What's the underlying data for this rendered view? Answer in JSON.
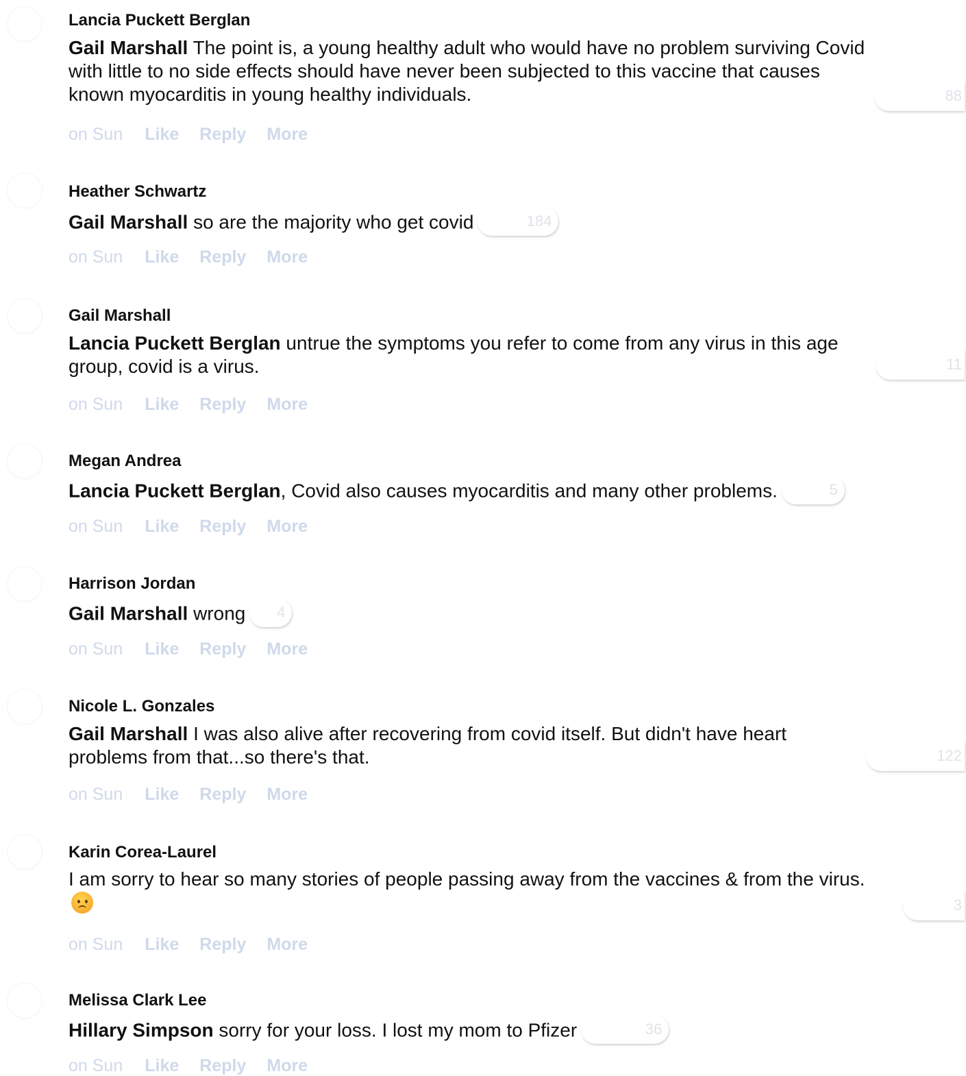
{
  "comments": [
    {
      "author": "Lancia Puckett Berglan",
      "mention": "Gail Marshall",
      "text": " The point is, a young healthy adult who would have no problem surviving Covid with little to no side effects should have never been subjected to this vaccine that causes known myocarditis in young healthy individuals.",
      "reaction_count": "88",
      "timestamp": "on Sun",
      "like_label": "Like",
      "reply_label": "Reply",
      "more_label": "More"
    },
    {
      "author": "Heather Schwartz",
      "mention": "Gail Marshall",
      "text": " so are the majority who get covid",
      "reaction_count": "184",
      "timestamp": "on Sun",
      "like_label": "Like",
      "reply_label": "Reply",
      "more_label": "More"
    },
    {
      "author": "Gail Marshall",
      "mention": "Lancia Puckett Berglan",
      "text": " untrue the symptoms you refer to come from any virus in this age group, covid is a virus.",
      "reaction_count": "11",
      "timestamp": "on Sun",
      "like_label": "Like",
      "reply_label": "Reply",
      "more_label": "More"
    },
    {
      "author": "Megan Andrea",
      "mention": "Lancia Puckett Berglan",
      "text": ", Covid also causes myocarditis and many other problems.",
      "reaction_count": "5",
      "timestamp": "on Sun",
      "like_label": "Like",
      "reply_label": "Reply",
      "more_label": "More"
    },
    {
      "author": "Harrison Jordan",
      "mention": "Gail Marshall",
      "text": " wrong",
      "reaction_count": "4",
      "timestamp": "on Sun",
      "like_label": "Like",
      "reply_label": "Reply",
      "more_label": "More"
    },
    {
      "author": "Nicole L. Gonzales",
      "mention": "Gail Marshall",
      "text": " I was also alive after recovering from covid itself. But didn't have heart problems from that...so there's that.",
      "reaction_count": "122",
      "timestamp": "on Sun",
      "like_label": "Like",
      "reply_label": "Reply",
      "more_label": "More"
    },
    {
      "author": "Karin Corea-Laurel",
      "text": "I am sorry to hear so many stories of people passing away from the vaccines & from the virus.",
      "reaction_count": "3",
      "emoji": "sad-face-emoji",
      "timestamp": "on Sun",
      "like_label": "Like",
      "reply_label": "Reply",
      "more_label": "More"
    },
    {
      "author": "Melissa Clark Lee",
      "mention": "Hillary Simpson",
      "text": " sorry for your loss. I lost my mom to Pfizer",
      "reaction_count": "36",
      "timestamp": "on Sun",
      "like_label": "Like",
      "reply_label": "Reply",
      "more_label": "More"
    }
  ]
}
